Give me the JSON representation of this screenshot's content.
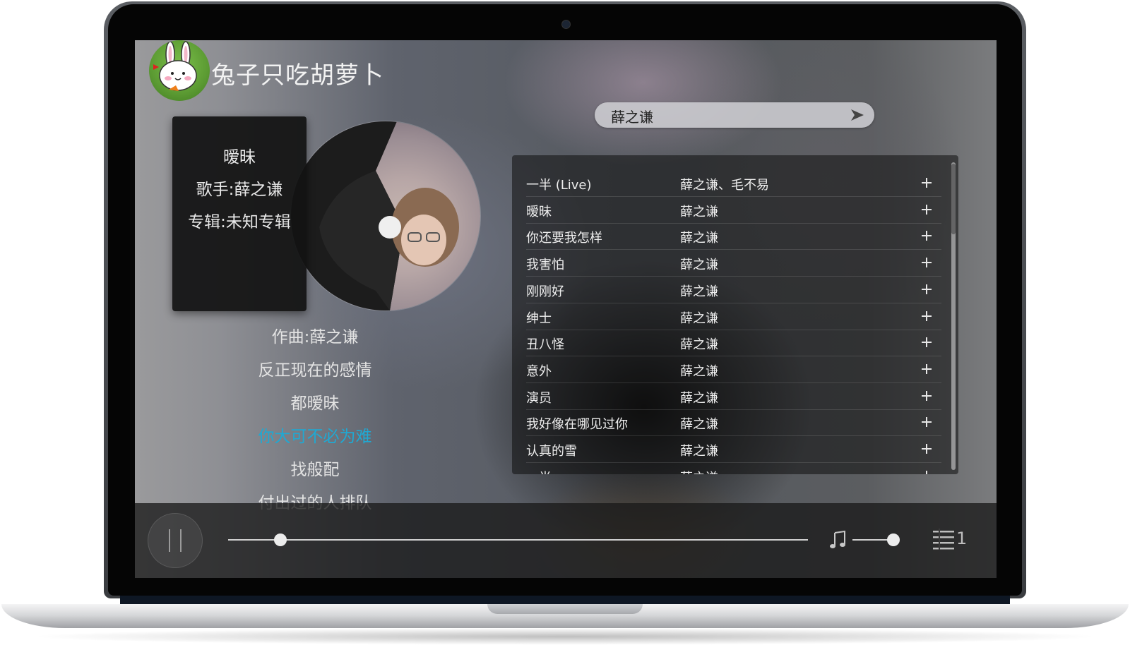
{
  "site": {
    "title": "兔子只吃胡萝卜"
  },
  "now_playing": {
    "song": "暧昧",
    "artist_line": "歌手:薛之谦",
    "album_line": "专辑:未知专辑"
  },
  "lyrics": {
    "lines": [
      "作曲:薛之谦",
      "反正现在的感情",
      "都暧昧",
      "你大可不必为难",
      "找般配",
      "付出过的人排队"
    ],
    "active_index": 3
  },
  "search": {
    "value": "薛之谦"
  },
  "playlist": {
    "rows": [
      {
        "name": "一半 (Live)",
        "artist": "薛之谦、毛不易"
      },
      {
        "name": "暧昧",
        "artist": "薛之谦"
      },
      {
        "name": "你还要我怎样",
        "artist": "薛之谦"
      },
      {
        "name": "我害怕",
        "artist": "薛之谦"
      },
      {
        "name": "刚刚好",
        "artist": "薛之谦"
      },
      {
        "name": "绅士",
        "artist": "薛之谦"
      },
      {
        "name": "丑八怪",
        "artist": "薛之谦"
      },
      {
        "name": "意外",
        "artist": "薛之谦"
      },
      {
        "name": "演员",
        "artist": "薛之谦"
      },
      {
        "name": "我好像在哪见过你",
        "artist": "薛之谦"
      },
      {
        "name": "认真的雪",
        "artist": "薛之谦"
      },
      {
        "name": "一半",
        "artist": "薛之谦"
      }
    ]
  },
  "player": {
    "progress_fraction": 0.09,
    "volume_fraction": 1.0,
    "queue_count": "1"
  },
  "colors": {
    "active_lyric": "#1fa9d3"
  }
}
